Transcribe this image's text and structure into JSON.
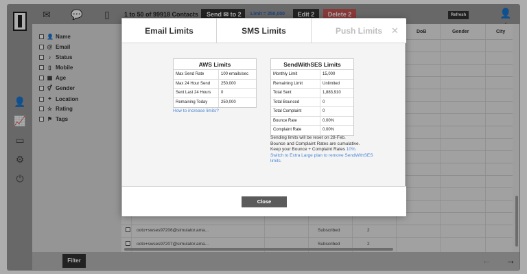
{
  "toolbar": {
    "contacts_text": "1 to 50 of 99918 Contacts",
    "send_label": "Send",
    "send_to": "to 2",
    "limit_text": "Limit = 250,000",
    "edit_label": "Edit 2",
    "delete_label": "Delete 2",
    "refresh_label": "Refresh"
  },
  "fields": [
    {
      "icon": "user-icon",
      "glyph": "👤",
      "label": "Name"
    },
    {
      "icon": "at-icon",
      "glyph": "@",
      "label": "Email"
    },
    {
      "icon": "bell-icon",
      "glyph": "🔔",
      "label": "Status"
    },
    {
      "icon": "mobile-icon",
      "glyph": "▯",
      "label": "Mobile"
    },
    {
      "icon": "calendar-icon",
      "glyph": "▦",
      "label": "Age"
    },
    {
      "icon": "gender-icon",
      "glyph": "⚥",
      "label": "Gender"
    },
    {
      "icon": "location-icon",
      "glyph": "⌖",
      "label": "Location"
    },
    {
      "icon": "star-icon",
      "glyph": "☆",
      "label": "Rating"
    },
    {
      "icon": "tag-icon",
      "glyph": "⚑",
      "label": "Tags"
    }
  ],
  "table": {
    "headers": {
      "dob": "DoB",
      "gender": "Gender",
      "city": "City"
    },
    "rows": [
      {
        "email": "ooto+swses97206@simulator.ama...",
        "status": "Subscribed",
        "num": "2"
      },
      {
        "email": "ooto+swses97207@simulator.ama...",
        "status": "Subscribed",
        "num": "2"
      }
    ]
  },
  "filter_label": "Filter",
  "modal": {
    "tabs": [
      "Email Limits",
      "SMS Limits",
      "Push Limits"
    ],
    "close_glyph": "✕",
    "aws": {
      "title": "AWS Limits",
      "rows": [
        {
          "k": "Max Send Rate",
          "v": "100 emails/sec"
        },
        {
          "k": "Max 24 Hour Send",
          "v": "250,000"
        },
        {
          "k": "Sent Last 24 Hours",
          "v": "0"
        },
        {
          "k": "Remaining Today",
          "v": "250,000"
        }
      ],
      "link": "How to increase limits?"
    },
    "ses": {
      "title": "SendWithSES Limits",
      "rows": [
        {
          "k": "Monthly Limit",
          "v": "15,000"
        },
        {
          "k": "Remaining Limit",
          "v": "Unlimited"
        },
        {
          "k": "Total Sent",
          "v": "1,883,910"
        },
        {
          "k": "Total Bounced",
          "v": "0"
        },
        {
          "k": "Total Complaint",
          "v": "0"
        },
        {
          "k": "Bounce Rate",
          "v": "0.00%"
        },
        {
          "k": "Complaint Rate",
          "v": "0.00%"
        }
      ]
    },
    "notes": {
      "line1": "Sending limits will be reset on 28-Feb.",
      "line2": "Bounce and Complaint Rates are cumulative.",
      "line3": "Keep your Bounce + Complaint Rates",
      "line3_link": "10%.",
      "line4": "Switch to Extra Large plan to remove SendWithSES",
      "line5": "limits."
    },
    "close_label": "Close"
  }
}
